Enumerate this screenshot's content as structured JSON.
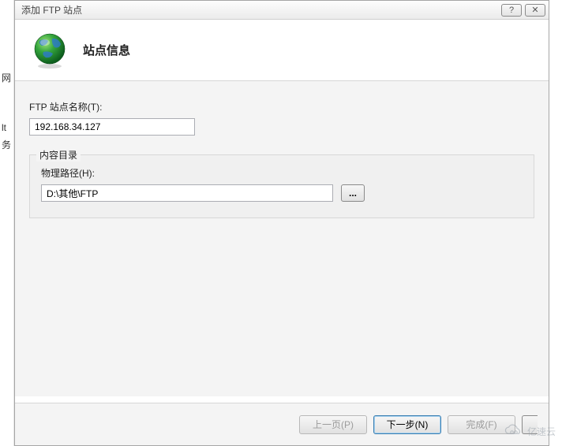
{
  "left_sidebar": {
    "text1": "网",
    "text2": "lt",
    "text3": "务"
  },
  "dialog": {
    "title": "添加 FTP 站点",
    "help_symbol": "?",
    "close_symbol": "✕"
  },
  "header": {
    "title": "站点信息"
  },
  "form": {
    "site_name_label": "FTP 站点名称(T):",
    "site_name_value": "192.168.34.127",
    "content_dir_group": "内容目录",
    "physical_path_label": "物理路径(H):",
    "physical_path_value": "D:\\其他\\FTP",
    "browse_label": "..."
  },
  "footer": {
    "prev": "上一页(P)",
    "next": "下一步(N)",
    "finish": "完成(F)",
    "cancel_partial": "  "
  },
  "watermark": {
    "text": "亿速云"
  }
}
